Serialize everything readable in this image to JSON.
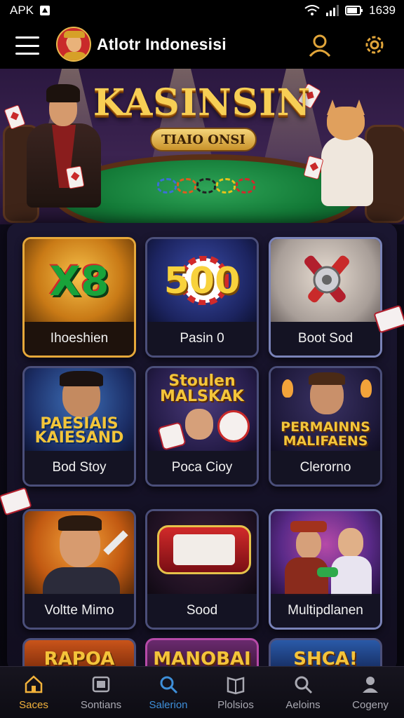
{
  "status_bar": {
    "carrier": "APK",
    "time": "1639"
  },
  "header": {
    "app_title": "Atlotr Indonesisi"
  },
  "banner": {
    "title": "KASINSIN",
    "subtitle": "TIAIO ONSI"
  },
  "games": [
    {
      "name": "Ihoeshien",
      "art_text": "X8",
      "style": "gold"
    },
    {
      "name": "Pasin 0",
      "art_text": "500",
      "style": "blue"
    },
    {
      "name": "Boot Sod",
      "art_text": "",
      "style": "blue"
    },
    {
      "name": "Bod Stoy",
      "art_text": "PAESIAIS KAIESAND",
      "style": "blue"
    },
    {
      "name": "Poca Cioy",
      "art_text": "Stoulen MALSKAK",
      "style": "blue"
    },
    {
      "name": "Clerorno",
      "art_text": "PERMAINNS MALIFAENS",
      "style": "blue"
    },
    {
      "name": "Voltte Mimo",
      "art_text": "",
      "style": "blue"
    },
    {
      "name": "Sood",
      "art_text": "",
      "style": "blue"
    },
    {
      "name": "Multipdlanen",
      "art_text": "",
      "style": "blue"
    }
  ],
  "partial_games": [
    {
      "art_text": "RAPOA"
    },
    {
      "art_text": "MANOBAI"
    },
    {
      "art_text": "SHCA!"
    }
  ],
  "bottom_nav": [
    {
      "label": "Saces",
      "icon": "home-icon",
      "state": "active"
    },
    {
      "label": "Sontians",
      "icon": "card-icon",
      "state": "normal"
    },
    {
      "label": "Salerion",
      "icon": "search-icon",
      "state": "highlight"
    },
    {
      "label": "Plolsios",
      "icon": "book-icon",
      "state": "normal"
    },
    {
      "label": "Aeloins",
      "icon": "search-icon",
      "state": "normal"
    },
    {
      "label": "Cogeny",
      "icon": "user-group-icon",
      "state": "normal"
    }
  ],
  "colors": {
    "accent_gold": "#f2b23b",
    "accent_blue": "#3e8fd9",
    "panel_bg": "#1a1630"
  }
}
